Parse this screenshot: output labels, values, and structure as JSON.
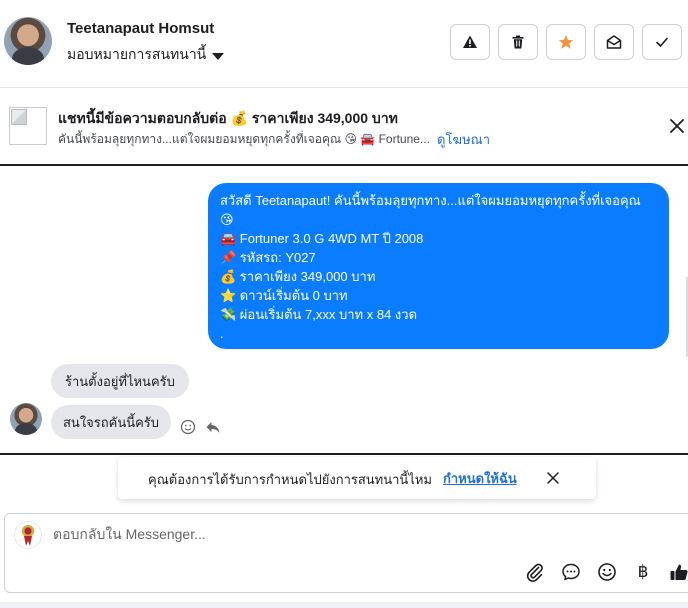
{
  "header": {
    "contact_name": "Teetanapaut Homsut",
    "assign_label": "มอบหมายการสนทนานี้",
    "buttons": [
      {
        "name": "report",
        "icon": "warning-icon"
      },
      {
        "name": "delete",
        "icon": "trash-icon"
      },
      {
        "name": "star",
        "icon": "star-icon",
        "color": "#f7923a"
      },
      {
        "name": "mark-unread",
        "icon": "envelope-open-icon"
      },
      {
        "name": "done",
        "icon": "checkmark-icon"
      }
    ]
  },
  "ad": {
    "title": "แชทนี้มีข้อความตอบกลับต่อ 💰 ราคาเพียง 349,000 บาท",
    "subtitle": "คันนี้พร้อมลุยทุกทาง...แต่ใจผมยอมหยุดทุกครั้งที่เจอคุณ 😘 🚘 Fortune...",
    "link": "ดูโฆษณา"
  },
  "messages": {
    "outgoing_lines": [
      "สวัสดี Teetanapaut! คันนี้พร้อมลุยทุกทาง...แต่ใจผมยอมหยุดทุกครั้งที่เจอคุณ",
      "😘",
      "🚘 Fortuner 3.0 G 4WD MT ปี 2008",
      "📌 รหัสรถ: Y027",
      "💰 ราคาเพียง 349,000 บาท",
      "⭐ ดาวน์เริ่มต้น 0 บาท",
      "💸 ผ่อนเริ่มต้น 7,xxx บาท x 84 งวด",
      "."
    ],
    "incoming_1": "ร้านตั้งอยู่ที่ไหนครับ",
    "incoming_2": "สนใจรถคันนี้ครับ",
    "outgoing_color": "#0a7cff"
  },
  "assign_toast": {
    "text": "คุณต้องการได้รับการกำหนดไปยังการสนทนานี้ไหม",
    "link": "กำหนดให้ฉัน"
  },
  "composer": {
    "placeholder": "ตอบกลับใน Messenger...",
    "tools": [
      "paperclip-icon",
      "chat-bubble-icon",
      "emoji-icon",
      "baht-icon",
      "thumbs-up-icon"
    ],
    "baht_symbol": "฿"
  }
}
